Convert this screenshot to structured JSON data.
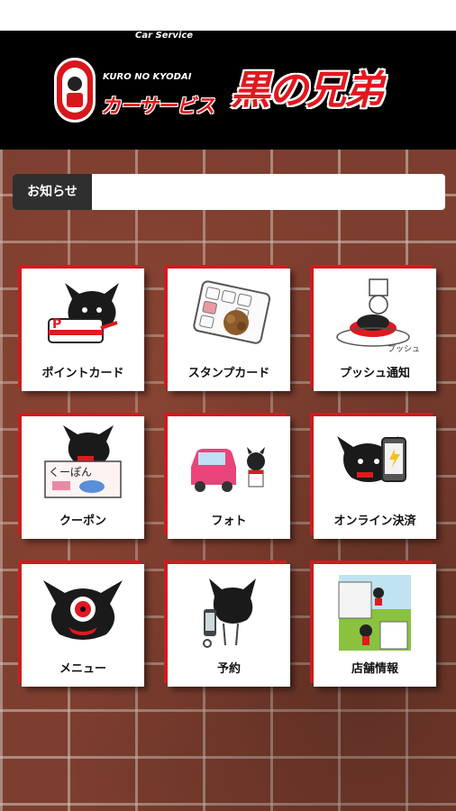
{
  "header": {
    "logo_subtitle_1": "Car Service",
    "logo_subtitle_2": "KURO NO KYODAI",
    "logo_kana": "カーサービス",
    "logo_title": "黒の兄弟"
  },
  "news": {
    "label": "お知らせ",
    "text": ""
  },
  "menu": {
    "items": [
      {
        "label": "ポイントカード",
        "icon": "point-card-icon"
      },
      {
        "label": "スタンプカード",
        "icon": "stamp-card-icon"
      },
      {
        "label": "プッシュ通知",
        "icon": "push-notification-icon"
      },
      {
        "label": "クーポン",
        "icon": "coupon-icon"
      },
      {
        "label": "フォト",
        "icon": "photo-icon"
      },
      {
        "label": "オンライン決済",
        "icon": "online-payment-icon"
      },
      {
        "label": "メニュー",
        "icon": "menu-icon"
      },
      {
        "label": "予約",
        "icon": "reservation-icon"
      },
      {
        "label": "店舗情報",
        "icon": "store-info-icon"
      }
    ]
  },
  "icon_art": {
    "point_card_letter": "P",
    "coupon_text": "くーぽん",
    "push_text": "プッシュ!"
  },
  "colors": {
    "header_bg": "#000000",
    "brand_red": "#e0191f",
    "tile_border": "#d11a1f",
    "news_label_bg": "#2f2f2f"
  }
}
